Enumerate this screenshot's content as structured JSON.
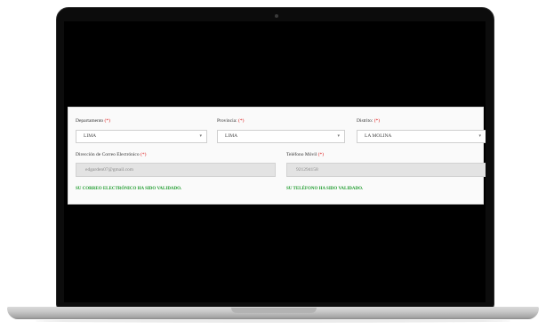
{
  "form": {
    "departamento": {
      "label": "Departamento",
      "required": "(*)",
      "value": "LIMA"
    },
    "provincia": {
      "label": "Provincia:",
      "required": "(*)",
      "value": "LIMA"
    },
    "distrito": {
      "label": "Distrito:",
      "required": "(*)",
      "value": "LA MOLINA"
    },
    "email": {
      "label": "Dirección de Correo Electrónico",
      "required": "(*)",
      "value": "edgarden07@gmail.com"
    },
    "phone": {
      "label": "Teléfono Móvil",
      "required": "(*)",
      "value": "921294158"
    },
    "email_validated": "SU CORREO ELECTRÓNICO HA SIDO VALIDADO.",
    "phone_validated": "SU TELÉFONO HA SIDO VALIDADO."
  },
  "colors": {
    "success": "#1c9b2b",
    "required": "#d22222",
    "screen": "#000000"
  }
}
